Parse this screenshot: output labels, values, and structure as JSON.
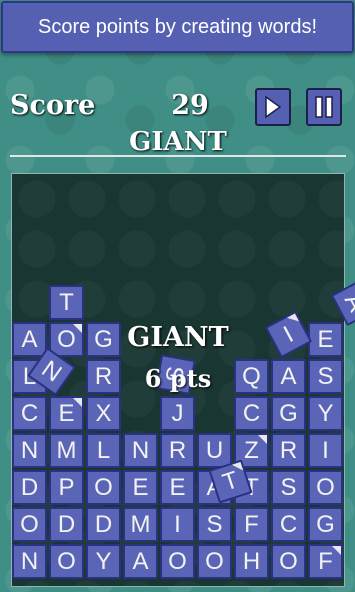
{
  "banner": {
    "text": "Score points by creating words!"
  },
  "header": {
    "score_label": "Score",
    "score_value": "29",
    "current_word": "GIANT"
  },
  "controls": {
    "play_icon": "play-icon",
    "pause_icon": "pause-icon"
  },
  "overlay": {
    "word": "GIANT",
    "points": "6 pts"
  },
  "colors": {
    "tile": "#5b65b8",
    "tile_border": "#2a3180",
    "board": "#193632",
    "background": "#3f8f86"
  },
  "grid": {
    "rows": [
      [
        "A",
        "O",
        "G",
        "",
        "",
        "",
        "",
        "",
        "E"
      ],
      [
        "L",
        "",
        "R",
        "",
        "",
        "",
        "Q",
        "A",
        "S"
      ],
      [
        "C",
        "E",
        "X",
        "",
        "J",
        "",
        "C",
        "G",
        "Y"
      ],
      [
        "N",
        "M",
        "L",
        "N",
        "R",
        "U",
        "Z",
        "R",
        "I"
      ],
      [
        "D",
        "P",
        "O",
        "E",
        "E",
        "A",
        "T",
        "S",
        "O"
      ],
      [
        "O",
        "D",
        "D",
        "M",
        "I",
        "S",
        "F",
        "C",
        "G"
      ],
      [
        "N",
        "O",
        "Y",
        "A",
        "O",
        "O",
        "H",
        "O",
        "F"
      ]
    ],
    "extra_top": "T"
  },
  "falling_tiles": [
    "N",
    "S",
    "T",
    "I",
    "A"
  ]
}
